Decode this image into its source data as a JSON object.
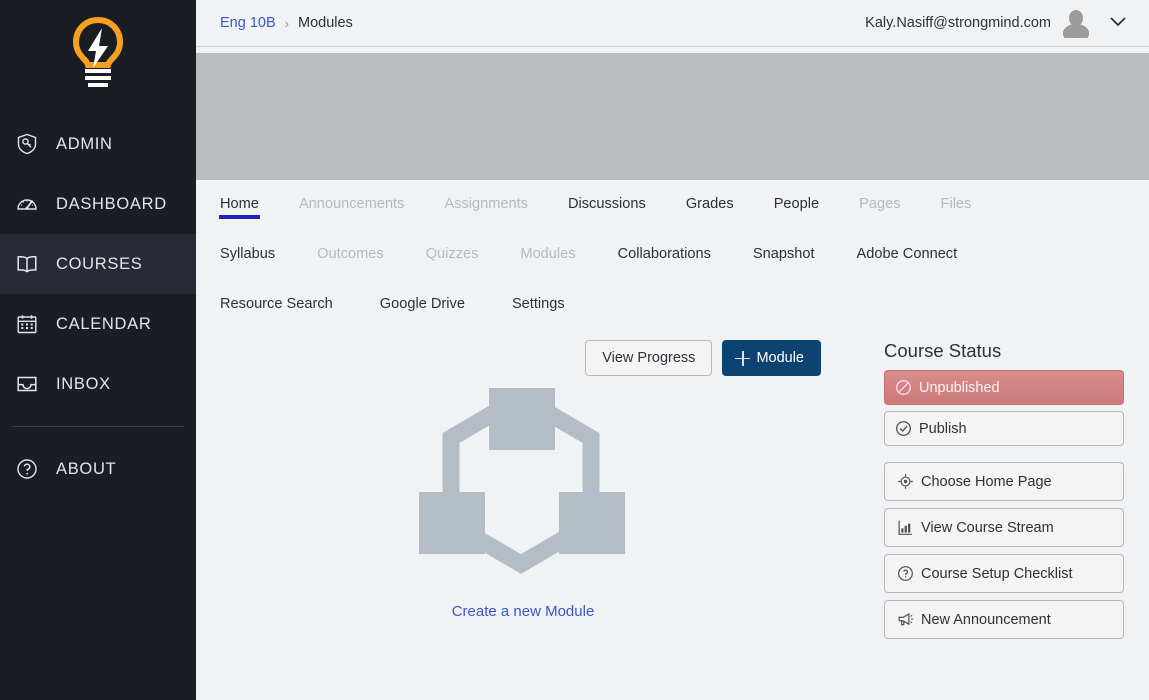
{
  "sidebar": {
    "logo_name": "lightbulb-logo",
    "logo_color": "#f5a01e",
    "background": "#1b1d25",
    "items": [
      {
        "label": "ADMIN",
        "icon": "shield-key-icon",
        "active": false
      },
      {
        "label": "DASHBOARD",
        "icon": "gauge-icon",
        "active": false
      },
      {
        "label": "COURSES",
        "icon": "book-icon",
        "active": true
      },
      {
        "label": "CALENDAR",
        "icon": "calendar-icon",
        "active": false
      },
      {
        "label": "INBOX",
        "icon": "inbox-icon",
        "active": false
      }
    ],
    "footer_items": [
      {
        "label": "ABOUT",
        "icon": "question-circle-icon",
        "active": false
      }
    ],
    "collapse_icon": "chevron-left-icon"
  },
  "header": {
    "breadcrumb": {
      "link": "Eng 10B",
      "separator": "›",
      "current": "Modules"
    },
    "user_email": "Kaly.Nasiff@strongmind.com",
    "avatar_icon": "user-avatar-icon",
    "dropdown_icon": "chevron-down-icon",
    "link_color": "#3b57c9"
  },
  "banner": {
    "color": "#bbbcbe"
  },
  "tabs": {
    "accent_color": "#2020c0",
    "rows": [
      [
        {
          "label": "Home",
          "state": "active"
        },
        {
          "label": "Announcements",
          "state": "disabled"
        },
        {
          "label": "Assignments",
          "state": "disabled"
        },
        {
          "label": "Discussions",
          "state": "normal"
        },
        {
          "label": "Grades",
          "state": "normal"
        },
        {
          "label": "People",
          "state": "normal"
        },
        {
          "label": "Pages",
          "state": "disabled"
        },
        {
          "label": "Files",
          "state": "disabled"
        }
      ],
      [
        {
          "label": "Syllabus",
          "state": "normal"
        },
        {
          "label": "Outcomes",
          "state": "disabled"
        },
        {
          "label": "Quizzes",
          "state": "disabled"
        },
        {
          "label": "Modules",
          "state": "disabled"
        },
        {
          "label": "Collaborations",
          "state": "normal"
        },
        {
          "label": "Snapshot",
          "state": "normal"
        },
        {
          "label": "Adobe Connect",
          "state": "normal"
        }
      ],
      [
        {
          "label": "Resource Search",
          "state": "normal"
        },
        {
          "label": "Google Drive",
          "state": "normal"
        },
        {
          "label": "Settings",
          "state": "normal"
        }
      ]
    ]
  },
  "content": {
    "view_progress_label": "View Progress",
    "add_module_label": "Module",
    "add_module_icon": "plus-icon",
    "empty_graphic_name": "modules-placeholder-graphic",
    "empty_link_label": "Create a new Module",
    "primary_button_color": "#0c4370"
  },
  "rail": {
    "title": "Course Status",
    "status": {
      "unpublished_label": "Unpublished",
      "unpublished_icon": "no-entry-icon",
      "unpublished_color": "#cc7a7c",
      "publish_label": "Publish",
      "publish_icon": "check-circle-icon"
    },
    "actions": [
      {
        "label": "Choose Home Page",
        "icon": "target-icon"
      },
      {
        "label": "View Course Stream",
        "icon": "bar-chart-icon"
      },
      {
        "label": "Course Setup Checklist",
        "icon": "question-circle-icon"
      },
      {
        "label": "New Announcement",
        "icon": "megaphone-icon"
      }
    ]
  }
}
